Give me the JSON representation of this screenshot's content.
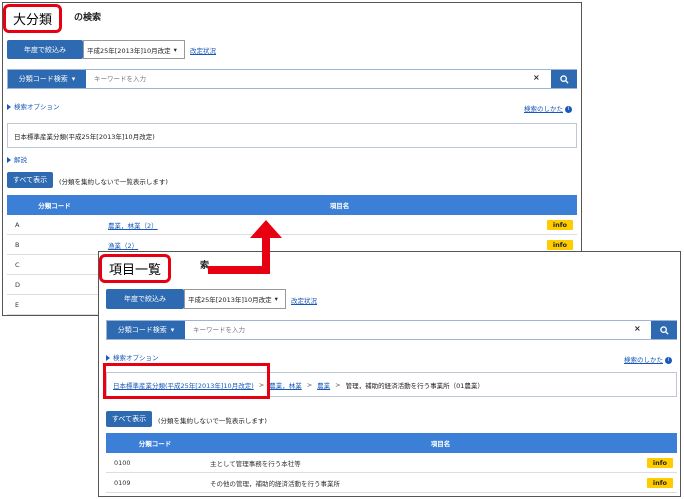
{
  "callouts": {
    "top": "大分類",
    "bottom": "項目一覧"
  },
  "panel1": {
    "page_title_tail": "の検索",
    "filter_label": "年度で絞込み",
    "filter_value": "平成25年[2013年]10月改定",
    "revision_link": "改定状況",
    "search_type": "分類コード検索",
    "search_placeholder": "キーワードを入力",
    "options_label": "検索オプション",
    "howto_link": "検索のしかた",
    "crumb": "日本標準産業分類(平成25年[2013年]10月改定)",
    "explain_label": "解説",
    "show_all": "すべて表示",
    "show_all_note": "(分類を集約しないで一覧表示します)",
    "table": {
      "col_code": "分類コード",
      "col_name": "項目名",
      "rows": [
        {
          "code": "A",
          "name": "農業，林業（2）",
          "badge": "info"
        },
        {
          "code": "B",
          "name": "漁業（2）",
          "badge": "info"
        },
        {
          "code": "C"
        },
        {
          "code": "D"
        },
        {
          "code": "E"
        }
      ]
    }
  },
  "panel2": {
    "title_fragment": "索",
    "filter_label": "年度で絞込み",
    "filter_value": "平成25年[2013年]10月改定",
    "revision_link": "改定状況",
    "search_type": "分類コード検索",
    "search_placeholder": "キーワードを入力",
    "options_label": "検索オプション",
    "howto_link": "検索のしかた",
    "crumb": {
      "root": "日本標準産業分類(平成25年[2013年]10月改定)",
      "sep": ">",
      "level1": "農業，林業",
      "level2": "農業",
      "current": "管理，補助的経済活動を行う事業所（01農業）"
    },
    "show_all": "すべて表示",
    "show_all_note": "(分類を集約しないで一覧表示します)",
    "table": {
      "col_code": "分類コード",
      "col_name": "項目名",
      "rows": [
        {
          "code": "0100",
          "name": "主として管理事務を行う本社等",
          "badge": "info"
        },
        {
          "code": "0109",
          "name": "その他の管理，補助的経済活動を行う事業所",
          "badge": "info"
        }
      ]
    }
  },
  "colors": {
    "accent_blue": "#2e6ab1",
    "header_blue": "#3b7fd6",
    "info_yellow": "#ffcc00",
    "highlight_red": "#e60012"
  }
}
